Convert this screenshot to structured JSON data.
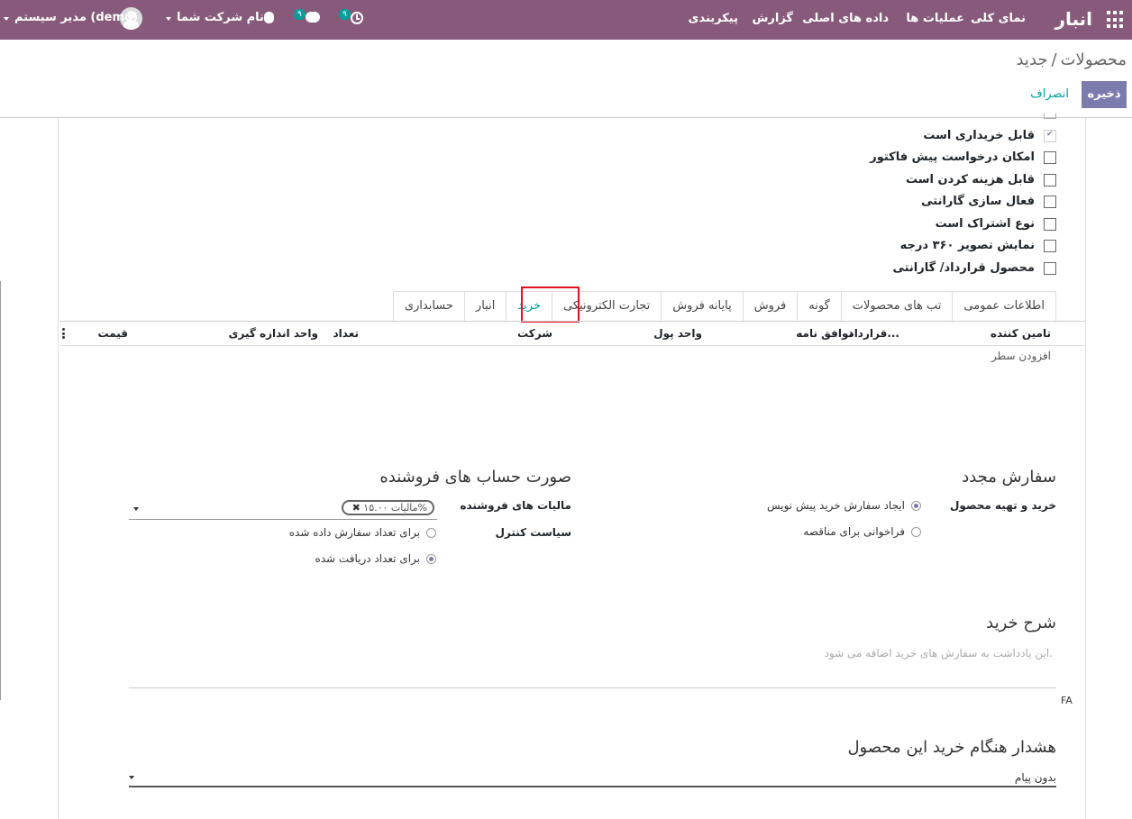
{
  "navbar": {
    "app_name": "انبار",
    "menu": [
      "نمای کلی",
      "عملیات ها",
      "داده های اصلی",
      "گزارش",
      "پیکربندی"
    ],
    "company": "نام شرکت شما",
    "user": "مدیر سیستم (demo)",
    "chat_count": "۹",
    "activity_count": "۹"
  },
  "breadcrumb": {
    "parent": "محصولات",
    "separator": "/",
    "current": "جدید"
  },
  "buttons": {
    "save": "ذخیره",
    "discard": "انصراف"
  },
  "checkboxes": [
    {
      "label": "قابل خریداری است",
      "checked": true
    },
    {
      "label": "امکان درخواست پیش فاکتور",
      "checked": false
    },
    {
      "label": "قابل هزینه کردن است",
      "checked": false
    },
    {
      "label": "فعال سازی گارانتی",
      "checked": false
    },
    {
      "label": "نوع اشتراک است",
      "checked": false
    },
    {
      "label": "نمایش تصویر ۳۶۰ درجه",
      "checked": false
    },
    {
      "label": "محصول قرارداد/ گارانتی",
      "checked": false
    }
  ],
  "tabs": [
    "اطلاعات عمومی",
    "تب های محصولات",
    "گونه",
    "فروش",
    "پایانه فروش",
    "تجارت الکترونیکی",
    "خرید",
    "انبار",
    "حسابداری"
  ],
  "active_tab": "خرید",
  "vendor_table": {
    "headers": [
      "تامین کننده",
      "قرارداد...",
      "توافق نامه",
      "واحد پول",
      "شرکت",
      "تعداد",
      "واحد اندازه گیری",
      "قیمت"
    ],
    "add_line": "افزودن سطر"
  },
  "reordering": {
    "title": "سفارش مجدد",
    "field_label": "خرید و تهیه محصول",
    "options": [
      {
        "label": "ایجاد سفارش خرید پیش نویس",
        "selected": true
      },
      {
        "label": "فراخوانی برای مناقصه",
        "selected": false
      }
    ]
  },
  "vendor_bills": {
    "title": "صورت حساب های فروشنده",
    "taxes_label": "مالیات های فروشنده",
    "tax_tag": "مالیات ۱۵.۰۰%",
    "control_label": "سیاست کنترل",
    "control_options": [
      {
        "label": "برای تعداد سفارش داده شده",
        "selected": false
      },
      {
        "label": "برای تعداد دریافت شده",
        "selected": true
      }
    ]
  },
  "purchase_description": {
    "title": "شرح خرید",
    "placeholder": "این یادداشت به سفارش های خرید اضافه می شود.",
    "lang": "FA"
  },
  "purchase_warning": {
    "title": "هشدار هنگام خرید این محصول",
    "value": "بدون پیام"
  },
  "colors": {
    "navbar": "#875a7b",
    "primary": "#7c7bad",
    "accent": "#00a09d",
    "highlight": "#e0101e"
  }
}
